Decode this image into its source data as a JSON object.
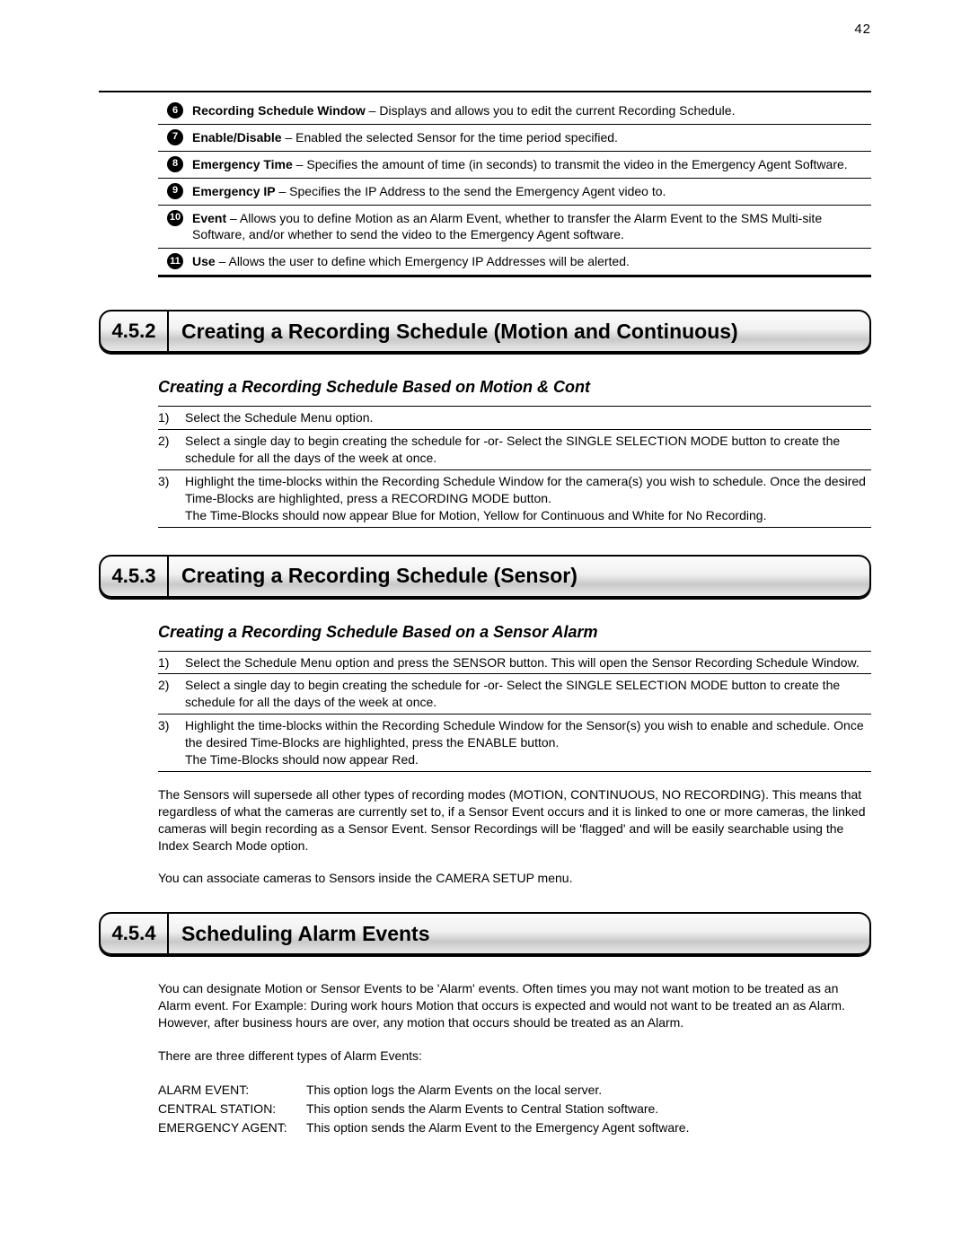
{
  "page_number": "42",
  "defs": [
    {
      "num": "6",
      "bold": "Recording Schedule Window",
      "rest": " – Displays and allows you to edit the current Recording Schedule."
    },
    {
      "num": "7",
      "bold": "Enable/Disable",
      "rest": " – Enabled the selected Sensor for the time period specified."
    },
    {
      "num": "8",
      "bold": "Emergency Time",
      "rest": " – Specifies the amount of time (in seconds) to transmit the video in the Emergency Agent Software."
    },
    {
      "num": "9",
      "bold": "Emergency IP",
      "rest": " – Specifies the IP Address to the send the Emergency Agent video to."
    },
    {
      "num": "10",
      "bold": "Event",
      "rest": " – Allows you to define Motion as an Alarm Event, whether to transfer the Alarm Event to the SMS Multi-site Software, and/or whether to send the video to the Emergency Agent software."
    },
    {
      "num": "11",
      "bold": "Use",
      "rest": " – Allows the user to define which Emergency IP Addresses will be alerted."
    }
  ],
  "section_452": {
    "num": "4.5.2",
    "title": "Creating a Recording Schedule (Motion and Continuous)",
    "subheading": "Creating a Recording Schedule Based on Motion & Cont",
    "steps": [
      {
        "n": "1)",
        "t": "Select the Schedule Menu option."
      },
      {
        "n": "2)",
        "t": "Select a single day to begin creating the schedule for -or- Select the SINGLE SELECTION MODE button to create the schedule for all the days of the week at once."
      },
      {
        "n": "3)",
        "t": "Highlight the time-blocks within the Recording Schedule Window for the camera(s) you wish to schedule. Once the desired Time-Blocks are highlighted, press a RECORDING MODE button.\nThe Time-Blocks should now appear Blue for Motion, Yellow for Continuous and White for No Recording."
      }
    ]
  },
  "section_453": {
    "num": "4.5.3",
    "title": "Creating a Recording Schedule (Sensor)",
    "subheading": "Creating a Recording Schedule Based on a Sensor Alarm",
    "steps": [
      {
        "n": "1)",
        "t": "Select the Schedule Menu option and press the SENSOR button. This will open the Sensor Recording Schedule Window."
      },
      {
        "n": "2)",
        "t": "Select a single day to begin creating the schedule for -or- Select the SINGLE SELECTION MODE button to create the schedule for all the days of the week at once."
      },
      {
        "n": "3)",
        "t": "Highlight the time-blocks within the Recording Schedule Window for the Sensor(s) you wish to enable and schedule. Once the desired Time-Blocks are highlighted, press the ENABLE button.\nThe Time-Blocks should now appear Red."
      }
    ],
    "para1": "The Sensors will supersede all other types of recording modes (MOTION, CONTINUOUS, NO RECORDING). This means that regardless of what the cameras are currently set to, if a Sensor Event occurs and it is linked to one or more cameras, the linked cameras will begin recording as a Sensor Event. Sensor Recordings will be 'flagged' and will be easily searchable using the Index Search Mode option.",
    "para2": "You can associate cameras to Sensors inside the CAMERA SETUP menu."
  },
  "section_454": {
    "num": "4.5.4",
    "title": "Scheduling Alarm Events",
    "para1": "You can designate Motion or Sensor Events to be 'Alarm' events. Often times you may not want motion to be treated as an Alarm event. For Example: During work hours Motion that occurs is expected and would not want to be treated an as Alarm. However, after business hours are over, any motion that occurs should be treated as an Alarm.",
    "para2": "There are three different types of Alarm Events:",
    "types": [
      {
        "label": "ALARM EVENT:",
        "desc": "This option logs the Alarm Events on the local server."
      },
      {
        "label": "CENTRAL STATION:",
        "desc": "This option sends the Alarm Events to Central Station software."
      },
      {
        "label": "EMERGENCY AGENT:",
        "desc": "This option sends the Alarm Event to the Emergency Agent software."
      }
    ]
  }
}
